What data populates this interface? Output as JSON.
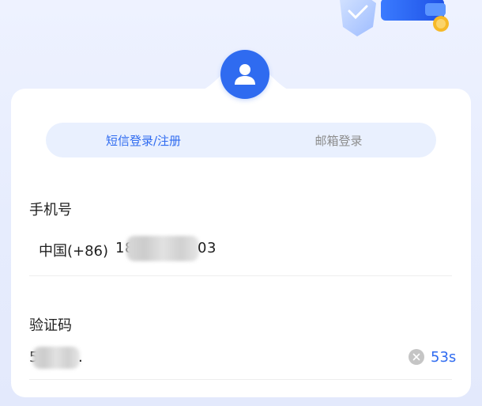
{
  "tabs": [
    {
      "label": "短信登录/注册",
      "active": true
    },
    {
      "label": "邮箱登录",
      "active": false
    }
  ],
  "phone": {
    "label": "手机号",
    "country_code": "中国(+86)",
    "value_prefix": "18",
    "value_suffix": "03"
  },
  "code": {
    "label": "验证码",
    "value_prefix": "5",
    "value_suffix": ".",
    "countdown": "53s"
  },
  "colors": {
    "accent": "#2f6bf0",
    "tab_bg": "#e9f0fe",
    "muted": "#8c8c8c"
  },
  "icons": {
    "avatar": "user-icon",
    "clear": "clear-icon",
    "decoration": "shield-coin-illustration"
  }
}
